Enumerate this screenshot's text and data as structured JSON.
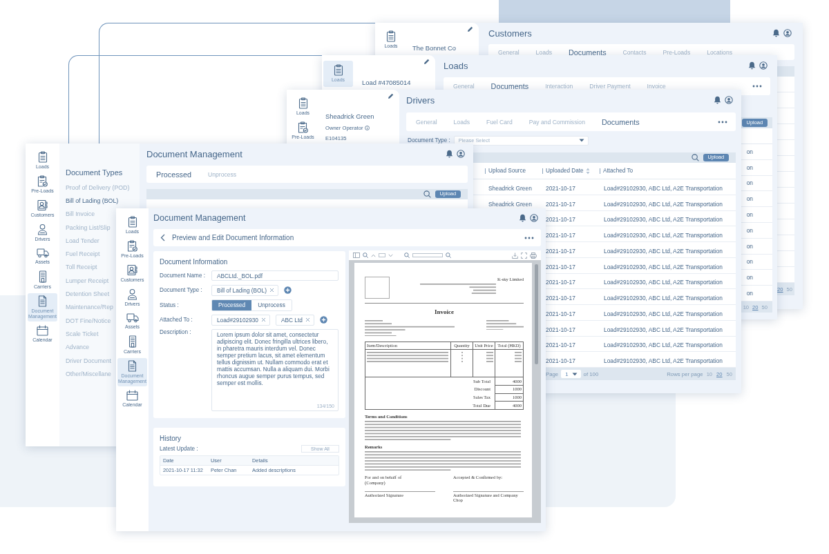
{
  "customers_window": {
    "title": "Customers",
    "nav": [
      {
        "label": "Loads",
        "selected": false
      }
    ],
    "record_name": "The Bonnet Co",
    "tabs": [
      {
        "label": "General",
        "selected": false
      },
      {
        "label": "Loads",
        "selected": false
      },
      {
        "label": "Documents",
        "selected": true
      },
      {
        "label": "Contacts",
        "selected": false
      },
      {
        "label": "Pre-Loads",
        "selected": false
      },
      {
        "label": "Locations",
        "selected": false
      }
    ],
    "rows_per_page": [
      {
        "label": "20",
        "selected": true
      },
      {
        "label": "50",
        "selected": false
      }
    ]
  },
  "loads_window": {
    "title": "Loads",
    "nav": [
      {
        "label": "Loads",
        "selected": true
      }
    ],
    "record_name": "Load #47085014",
    "tabs": [
      {
        "label": "General",
        "selected": false
      },
      {
        "label": "Documents",
        "selected": true
      },
      {
        "label": "Interaction",
        "selected": false
      },
      {
        "label": "Driver Payment",
        "selected": false
      },
      {
        "label": "Invoice",
        "selected": false
      }
    ],
    "upload_button": "Upload",
    "rows": [
      {
        "attached_to": "on"
      },
      {
        "attached_to": "on"
      },
      {
        "attached_to": "on"
      },
      {
        "attached_to": "on"
      },
      {
        "attached_to": "on"
      },
      {
        "attached_to": "on"
      },
      {
        "attached_to": "on"
      },
      {
        "attached_to": "on"
      },
      {
        "attached_to": "on"
      },
      {
        "attached_to": "on"
      }
    ],
    "rows_per_page": [
      {
        "label": "10",
        "selected": false
      },
      {
        "label": "20",
        "selected": true
      },
      {
        "label": "50",
        "selected": false
      }
    ]
  },
  "drivers_window": {
    "title": "Drivers",
    "nav": [
      {
        "label": "Loads",
        "selected": false
      },
      {
        "label": "Pre-Loads",
        "selected": false
      }
    ],
    "driver": {
      "name": "Sheadrick Green",
      "type": "Owner Operator",
      "id": "E104135"
    },
    "tabs": [
      {
        "label": "General",
        "selected": false
      },
      {
        "label": "Loads",
        "selected": false
      },
      {
        "label": "Fuel Card",
        "selected": false
      },
      {
        "label": "Pay and Commission",
        "selected": false
      },
      {
        "label": "Documents",
        "selected": true
      }
    ],
    "filter": {
      "label": "Document Type :",
      "placeholder": "Please Select"
    },
    "upload_button": "Upload",
    "columns": [
      "Upload Source",
      "Uploaded Date",
      "Attached To"
    ],
    "rows": [
      {
        "upload_source": "Sheadrick Green",
        "uploaded_date": "2021-10-17",
        "attached_to": "Load#29102930, ABC Ltd, A2E Transportation"
      },
      {
        "upload_source": "Sheadrick Green",
        "uploaded_date": "2021-10-17",
        "attached_to": "Load#29102930, ABC Ltd, A2E Transportation"
      },
      {
        "uploaded_date": "2021-10-17",
        "attached_to": "Load#29102930, ABC Ltd, A2E Transportation"
      },
      {
        "uploaded_date": "2021-10-17",
        "attached_to": "Load#29102930, ABC Ltd, A2E Transportation"
      },
      {
        "uploaded_date": "2021-10-17",
        "attached_to": "Load#29102930, ABC Ltd, A2E Transportation"
      },
      {
        "uploaded_date": "2021-10-17",
        "attached_to": "Load#29102930, ABC Ltd, A2E Transportation"
      },
      {
        "uploaded_date": "2021-10-17",
        "attached_to": "Load#29102930, ABC Ltd, A2E Transportation"
      },
      {
        "uploaded_date": "2021-10-17",
        "attached_to": "Load#29102930, ABC Ltd, A2E Transportation"
      },
      {
        "uploaded_date": "2021-10-17",
        "attached_to": "Load#29102930, ABC Ltd, A2E Transportation"
      },
      {
        "uploaded_date": "2021-10-17",
        "attached_to": "Load#29102930, ABC Ltd, A2E Transportation"
      },
      {
        "uploaded_date": "2021-10-17",
        "attached_to": "Load#29102930, ABC Ltd, A2E Transportation"
      },
      {
        "uploaded_date": "2021-10-17",
        "attached_to": "Load#29102930, ABC Ltd, A2E Transportation"
      }
    ],
    "pagination": {
      "page_label": "Page",
      "page": "1",
      "total": "of 100",
      "rows_per_page_label": "Rows per page",
      "rows_per_page": [
        {
          "label": "10",
          "selected": false
        },
        {
          "label": "20",
          "selected": true
        },
        {
          "label": "50",
          "selected": false
        }
      ]
    }
  },
  "document_types_window": {
    "title": "Document Management",
    "nav": [
      {
        "label": "Loads",
        "selected": false
      },
      {
        "label": "Pre-Loads",
        "selected": false
      },
      {
        "label": "Customers",
        "selected": false
      },
      {
        "label": "Drivers",
        "selected": false
      },
      {
        "label": "Assets",
        "selected": false
      },
      {
        "label": "Carriers",
        "selected": false
      },
      {
        "label": "Document Management",
        "selected": true
      },
      {
        "label": "Calendar",
        "selected": false
      }
    ],
    "panel_title": "Document Types",
    "document_types": [
      {
        "label": "Proof of Delivery (POD)",
        "selected": false
      },
      {
        "label": "Bill of Lading (BOL)",
        "selected": true
      },
      {
        "label": "Bill Invoice",
        "selected": false
      },
      {
        "label": "Packing List/Slip",
        "selected": false
      },
      {
        "label": "Load Tender",
        "selected": false
      },
      {
        "label": "Fuel Receipt",
        "selected": false
      },
      {
        "label": "Toll Receipt",
        "selected": false
      },
      {
        "label": "Lumper Receipt",
        "selected": false
      },
      {
        "label": "Detention Sheet",
        "selected": false
      },
      {
        "label": "Maintenance/Rep",
        "selected": false
      },
      {
        "label": "DOT Fine/Notice",
        "selected": false
      },
      {
        "label": "Scale Ticket",
        "selected": false
      },
      {
        "label": "Advance",
        "selected": false
      },
      {
        "label": "Driver Document",
        "selected": false
      },
      {
        "label": "Other/Miscellane",
        "selected": false
      }
    ],
    "tabs": [
      {
        "label": "Processed",
        "selected": true
      },
      {
        "label": "Unprocess",
        "selected": false
      }
    ],
    "upload_button": "Upload"
  },
  "document_window": {
    "title": "Document Management",
    "nav": [
      {
        "label": "Loads",
        "selected": false
      },
      {
        "label": "Pre-Loads",
        "selected": false
      },
      {
        "label": "Customers",
        "selected": false
      },
      {
        "label": "Drivers",
        "selected": false
      },
      {
        "label": "Assets",
        "selected": false
      },
      {
        "label": "Carriers",
        "selected": false
      },
      {
        "label": "Document Management",
        "selected": true
      },
      {
        "label": "Calendar",
        "selected": false
      }
    ],
    "heading": "Preview and Edit Document Information",
    "info": {
      "title": "Document Information",
      "name_label": "Document Name :",
      "name_value": "ABCLtd._BOL.pdf",
      "type_label": "Document Type :",
      "type_tags": [
        "Bill of Lading (BOL)"
      ],
      "status_label": "Status :",
      "status_options": [
        {
          "label": "Processed",
          "selected": true
        },
        {
          "label": "Unprocess",
          "selected": false
        }
      ],
      "attached_label": "Attached To :",
      "attached_tags": [
        "Load#29102930",
        "ABC Ltd"
      ],
      "description_label": "Description :",
      "description": "Lorem ipsum dolor sit amet, consectetur adipiscing elit. Donec fringilla ultrices libero, in pharetra mauris interdum vel. Donec semper pretium lacus, sit amet elementum tellus dignissim ut. Nullam commodo erat et mattis accumsan. Nulla a aliquam dui. Morbi rhoncus augue semper purus tempus, sed semper est mollis.",
      "char_count": "134/150"
    },
    "history": {
      "title": "History",
      "latest_label": "Latest Update :",
      "show_all": "Show All",
      "columns": [
        "Date",
        "User",
        "Details"
      ],
      "rows": [
        [
          "2021-10-17 11:32",
          "Peter Chan",
          "Added descriptions"
        ]
      ]
    },
    "invoice": {
      "company": "K-sky Limited",
      "title": "Invoice",
      "columns": [
        "Item/Description",
        "Quantity",
        "Unit Price",
        "Total (HKD)"
      ],
      "totals": [
        [
          "Sub Total",
          "4000"
        ],
        [
          "Discount",
          "1000"
        ],
        [
          "Sales Tax",
          "1000"
        ],
        [
          "Total Due",
          "4000"
        ]
      ],
      "sections": [
        {
          "heading": "Terms and Conditions"
        },
        {
          "heading": "Remarks"
        }
      ],
      "signatures": [
        {
          "note": [
            "For and on behalf of",
            "(Company)"
          ],
          "line_label": "Authorized Signature"
        },
        {
          "note": [
            "Accepted & Confirmed by:"
          ],
          "line_label": "Authorized Signature and Company Chop"
        }
      ]
    }
  }
}
